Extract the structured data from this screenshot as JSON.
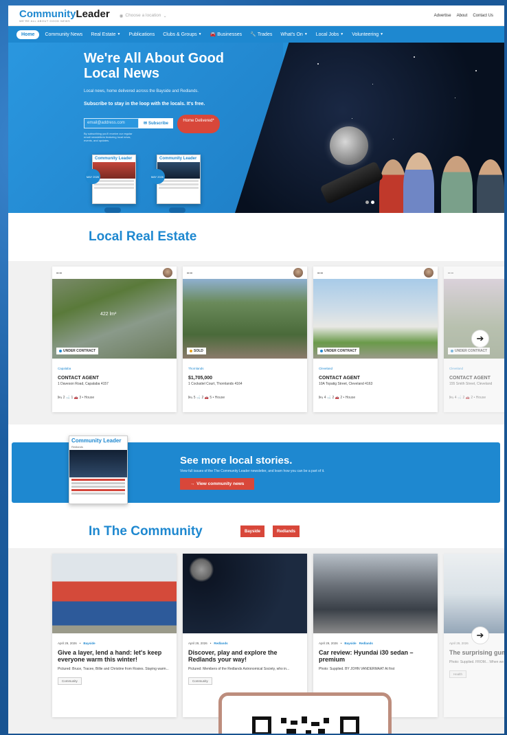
{
  "topbar": {
    "logo_main_1": "Community",
    "logo_main_2": "Leader",
    "logo_tag": "WE'RE ALL ABOUT GOOD NEWS",
    "location": "Choose a location",
    "links": [
      "Advertise",
      "About",
      "Contact Us"
    ]
  },
  "nav": {
    "items": [
      {
        "label": "Home",
        "active": true
      },
      {
        "label": "Community News"
      },
      {
        "label": "Real Estate",
        "caret": true
      },
      {
        "label": "Publications"
      },
      {
        "label": "Clubs & Groups",
        "caret": true
      },
      {
        "label": "Businesses",
        "icon": "car-icon"
      },
      {
        "label": "Trades",
        "icon": "wrench-icon"
      },
      {
        "label": "What's On",
        "caret": true
      },
      {
        "label": "Local Jobs",
        "caret": true
      },
      {
        "label": "Volunteering",
        "caret": true
      }
    ]
  },
  "hero": {
    "title": "We're All About Good Local News",
    "subtitle": "Local news, home delivered across the Bayside and Redlands.",
    "subtitle2": "Subscribe to stay in the loop with the locals. It's free.",
    "email_placeholder": "email@address.com",
    "subscribe_label": "Subscribe",
    "home_delivered_label": "Home Delivered*",
    "fine_print": "By subscribing you'll receive our regular email newsletters featuring local news, events, and updates.",
    "covers": [
      {
        "title": "Community Leader",
        "month": "MAY 2026"
      },
      {
        "title": "Community Leader",
        "month": "MAY 2026"
      }
    ]
  },
  "real_estate": {
    "title": "Local Real Estate",
    "listings": [
      {
        "status": "UNDER CONTRACT",
        "status_color": "#1e88d0",
        "suburb": "Capalaba",
        "price": "CONTACT AGENT",
        "address": "1 Daveson Road, Capalaba 4157",
        "beds": "2",
        "baths": "1",
        "cars": "3",
        "type": "House",
        "overlay": "422 lm²"
      },
      {
        "status": "SOLD",
        "status_color": "#e8a21c",
        "suburb": "Thornlands",
        "price": "$1,705,000",
        "address": "1 Cockatiel Court, Thornlands 4164",
        "beds": "5",
        "baths": "2",
        "cars": "5",
        "type": "House"
      },
      {
        "status": "UNDER CONTRACT",
        "status_color": "#1e88d0",
        "suburb": "Cleveland",
        "price": "CONTACT AGENT",
        "address": "10A Topatig Street, Cleveland 4163",
        "beds": "4",
        "baths": "2",
        "cars": "2",
        "type": "House"
      },
      {
        "status": "UNDER CONTRACT",
        "status_color": "#1e88d0",
        "suburb": "Cleveland",
        "price": "CONTACT AGENT",
        "address": "155 Smith Street, Cleveland",
        "beds": "4",
        "baths": "2",
        "cars": "2",
        "type": "House"
      }
    ]
  },
  "stories": {
    "cover_title": "Community Leader",
    "cover_sub": "Redlands",
    "title": "See more local stories.",
    "subtitle": "View full issues of the The Community Leader newsletter, and learn how you can be a part of it.",
    "button": "View community news"
  },
  "community": {
    "title": "In The Community",
    "tags": [
      "Bayside",
      "Redlands"
    ],
    "articles": [
      {
        "date": "April 29, 2026",
        "locations": [
          "Bayside"
        ],
        "title": "Give a layer, lend a hand: let's keep everyone warm this winter!",
        "excerpt": "Pictured: Bruce, Tracee, Billie and Christine from Rosies. Staying warm...",
        "tag": "Community"
      },
      {
        "date": "April 29, 2026",
        "locations": [
          "Redlands"
        ],
        "title": "Discover, play and explore the Redlands your way!",
        "excerpt": "Pictured: Members of the Redlands Astronomical Society, who in...",
        "tag": "Community"
      },
      {
        "date": "April 29, 2026",
        "locations": [
          "Bayside",
          "Redlands"
        ],
        "title": "Car review: Hyundai i30 sedan – premium",
        "excerpt": "Photo: Supplied. BY JOHN VANDERMAAT At first",
        "tag": ""
      },
      {
        "date": "April 29, 2026",
        "locations": [],
        "title": "The surprising gum health an",
        "excerpt": "Photo: Supplied. FROM... When we think about...",
        "tag": "Health"
      }
    ]
  },
  "colors": {
    "brand": "#1e88d0",
    "accent_red": "#d8473a"
  }
}
